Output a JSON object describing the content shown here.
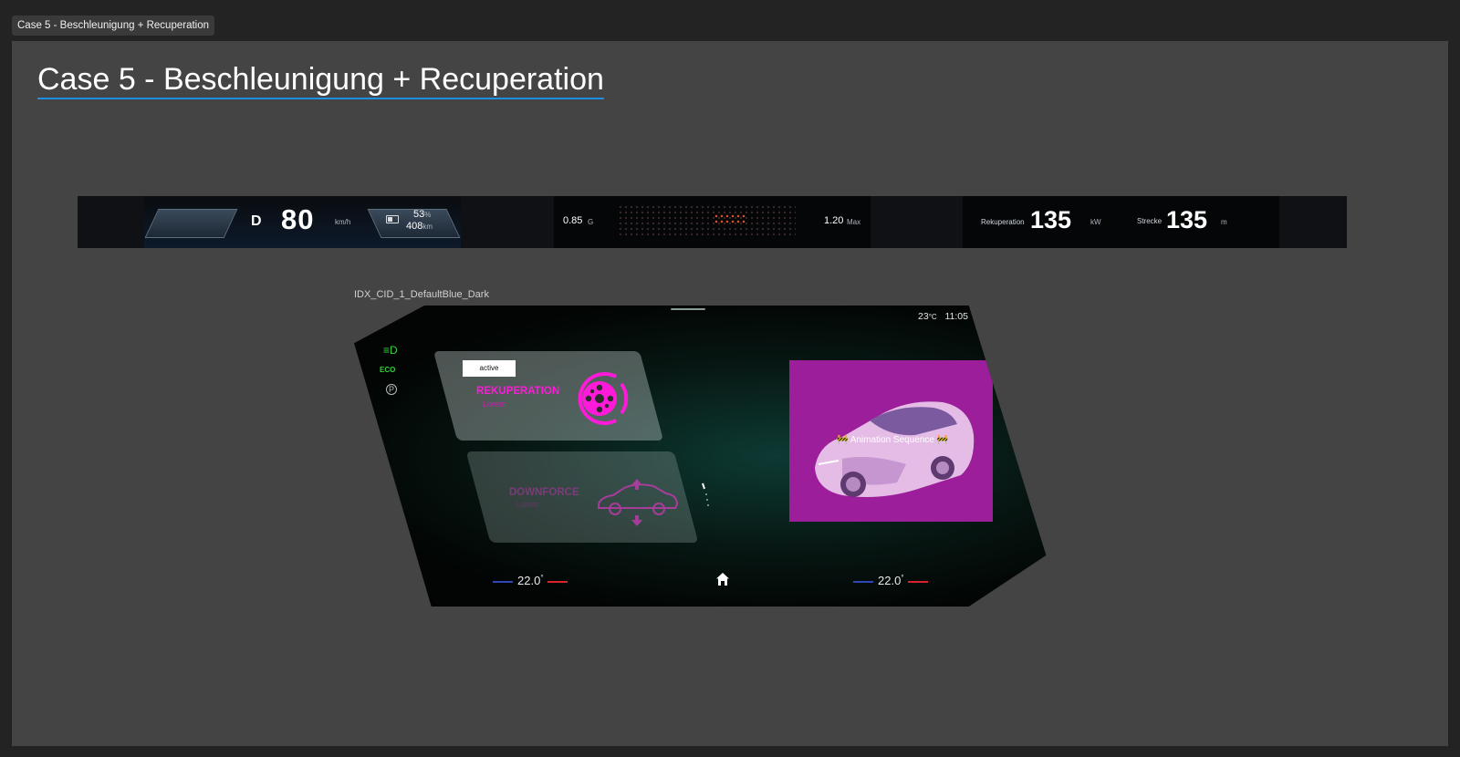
{
  "frame_tab": {
    "label": "Case 5 - Beschleunigung + Recuperation"
  },
  "page": {
    "title": "Case 5 - Beschleunigung + Recuperation"
  },
  "cluster": {
    "drive": {
      "gear": "D",
      "speed": "80",
      "speed_unit": "km/h",
      "battery_percent": "53",
      "battery_percent_unit": "%",
      "range": "408",
      "range_unit": "km"
    },
    "gforce": {
      "current": "0.85",
      "current_unit": "G",
      "max": "1.20",
      "max_unit": "Max"
    },
    "recuperation": {
      "label": "Rekuperation",
      "value": "135",
      "unit": "kW",
      "distance_label": "Strecke",
      "distance_value": "135",
      "distance_unit": "m"
    }
  },
  "cid": {
    "label": "IDX_CID_1_DefaultBlue_Dark",
    "status": {
      "outside_temp": "23",
      "temp_unit": "°C",
      "time": "11:05"
    },
    "side_icons": [
      "headlight-icon",
      "eco-mode-icon",
      "parking-brake-icon"
    ],
    "cards": {
      "recuperation": {
        "badge": "active",
        "title": "REKUPERATION",
        "subtitle": "Lorem"
      },
      "downforce": {
        "title": "DOWNFORCE",
        "subtitle": "Lorem"
      }
    },
    "animation": {
      "label": "Animation Sequence"
    },
    "climate": {
      "left_temp": "22.0",
      "right_temp": "22.0",
      "unit": "°"
    }
  },
  "colors": {
    "accent_magenta": "#ff1ad9",
    "animation_bg": "#9c1e9a",
    "status_green": "#35d13c",
    "title_underline": "#1e8fe0",
    "temp_cold": "#3046b8",
    "temp_hot": "#d6232e"
  }
}
